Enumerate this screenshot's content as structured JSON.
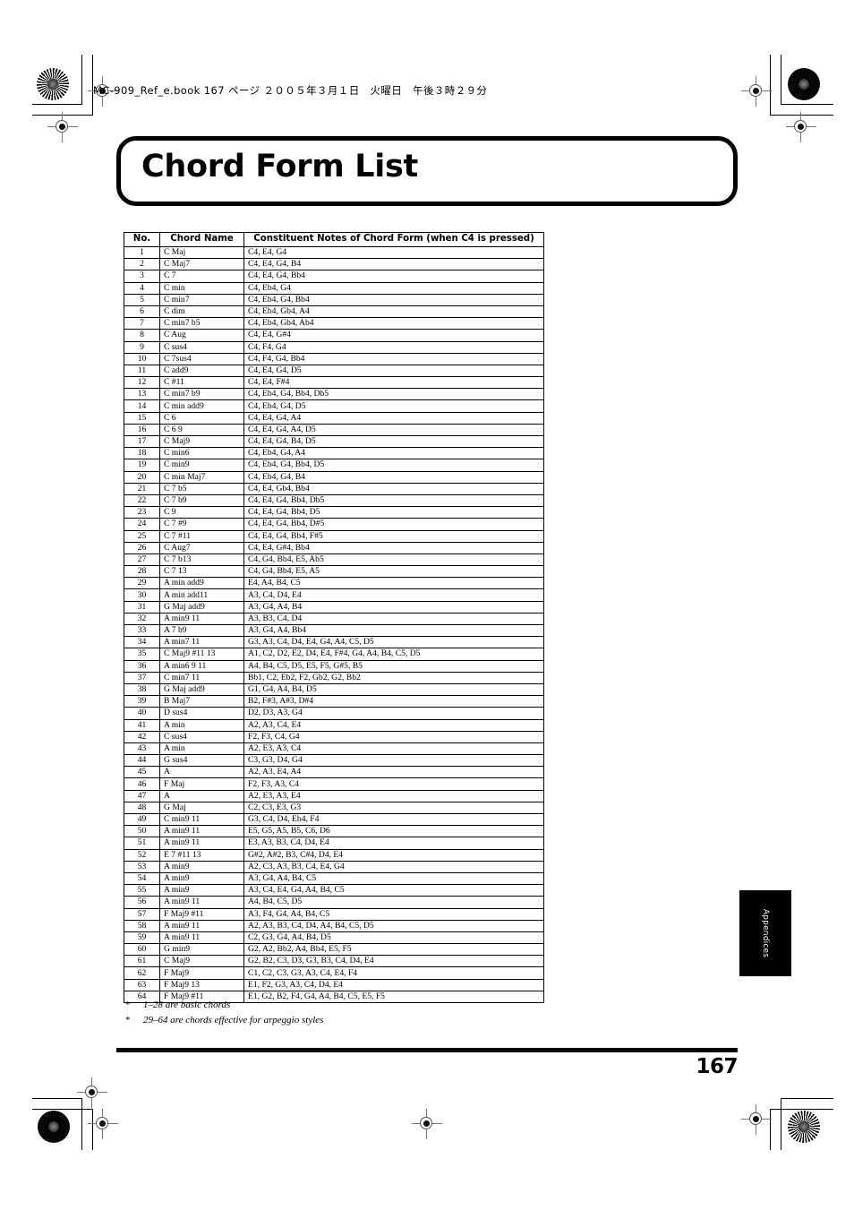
{
  "page": {
    "book_header": "MC-909_Ref_e.book  167 ページ  ２００５年３月１日　火曜日　午後３時２９分",
    "title": "Chord Form List",
    "folio": "167",
    "side_tab": "Appendices"
  },
  "table": {
    "headers": [
      "No.",
      "Chord Name",
      "Constituent Notes of Chord Form (when C4 is pressed)"
    ],
    "rows": [
      [
        "1",
        "C Maj",
        "C4, E4, G4"
      ],
      [
        "2",
        "C Maj7",
        "C4, E4, G4, B4"
      ],
      [
        "3",
        "C 7",
        "C4, E4, G4, Bb4"
      ],
      [
        "4",
        "C min",
        "C4, Eb4, G4"
      ],
      [
        "5",
        "C min7",
        "C4, Eb4, G4, Bb4"
      ],
      [
        "6",
        "C dim",
        "C4, Eb4, Gb4, A4"
      ],
      [
        "7",
        "C min7 b5",
        "C4, Eb4, Gb4, Ab4"
      ],
      [
        "8",
        "C Aug",
        "C4, E4, G#4"
      ],
      [
        "9",
        "C sus4",
        "C4, F4, G4"
      ],
      [
        "10",
        "C 7sus4",
        "C4, F4, G4, Bb4"
      ],
      [
        "11",
        "C add9",
        "C4, E4, G4, D5"
      ],
      [
        "12",
        "C #11",
        "C4, E4, F#4"
      ],
      [
        "13",
        "C min7 b9",
        "C4, Eb4, G4, Bb4, Db5"
      ],
      [
        "14",
        "C min add9",
        "C4, Eb4, G4, D5"
      ],
      [
        "15",
        "C 6",
        "C4, E4, G4, A4"
      ],
      [
        "16",
        "C 6 9",
        "C4, E4, G4, A4, D5"
      ],
      [
        "17",
        "C Maj9",
        "C4, E4, G4, B4, D5"
      ],
      [
        "18",
        "C min6",
        "C4, Eb4, G4, A4"
      ],
      [
        "19",
        "C min9",
        "C4, Eb4, G4, Bb4, D5"
      ],
      [
        "20",
        "C min Maj7",
        "C4, Eb4, G4, B4"
      ],
      [
        "21",
        "C 7 b5",
        "C4, E4, Gb4, Bb4"
      ],
      [
        "22",
        "C 7 b9",
        "C4, E4, G4, Bb4, Db5"
      ],
      [
        "23",
        "C 9",
        "C4, E4, G4, Bb4, D5"
      ],
      [
        "24",
        "C 7 #9",
        "C4, E4, G4, Bb4, D#5"
      ],
      [
        "25",
        "C 7 #11",
        "C4, E4, G4, Bb4, F#5"
      ],
      [
        "26",
        "C Aug7",
        "C4, E4, G#4, Bb4"
      ],
      [
        "27",
        "C 7 b13",
        "C4, G4, Bb4, E5, Ab5"
      ],
      [
        "28",
        "C 7 13",
        "C4, G4, Bb4, E5, A5"
      ],
      [
        "29",
        "A min add9",
        "E4, A4, B4, C5"
      ],
      [
        "30",
        "A min add11",
        "A3, C4, D4, E4"
      ],
      [
        "31",
        "G Maj add9",
        "A3, G4, A4, B4"
      ],
      [
        "32",
        "A min9 11",
        "A3, B3, C4, D4"
      ],
      [
        "33",
        "A 7 b9",
        "A3, G4, A4, Bb4"
      ],
      [
        "34",
        "A min7 11",
        "G3, A3, C4, D4, E4, G4, A4, C5, D5"
      ],
      [
        "35",
        "C Maj9 #11 13",
        "A1, C2, D2, E2, D4, E4, F#4, G4, A4, B4, C5, D5"
      ],
      [
        "36",
        "A min6 9 11",
        "A4, B4, C5, D5, E5, F5, G#5, B5"
      ],
      [
        "37",
        "C min7 11",
        "Bb1, C2, Eb2, F2, Gb2, G2, Bb2"
      ],
      [
        "38",
        "G Maj add9",
        "G1, G4, A4, B4, D5"
      ],
      [
        "39",
        "B Maj7",
        "B2, F#3, A#3, D#4"
      ],
      [
        "40",
        "D sus4",
        "D2, D3, A3, G4"
      ],
      [
        "41",
        "A min",
        "A2, A3, C4, E4"
      ],
      [
        "42",
        "C sus4",
        "F2, F3, C4, G4"
      ],
      [
        "43",
        "A min",
        "A2, E3, A3, C4"
      ],
      [
        "44",
        "G sus4",
        "C3, G3, D4, G4"
      ],
      [
        "45",
        "A",
        "A2, A3, E4, A4"
      ],
      [
        "46",
        "F Maj",
        "F2, F3, A3, C4"
      ],
      [
        "47",
        "A",
        "A2, E3, A3, E4"
      ],
      [
        "48",
        "G Maj",
        "C2, C3, E3, G3"
      ],
      [
        "49",
        "C min9 11",
        "G3, C4, D4, Eb4, F4"
      ],
      [
        "50",
        "A min9 11",
        "E5, G5, A5, B5, C6, D6"
      ],
      [
        "51",
        "A min9 11",
        "E3, A3, B3, C4, D4, E4"
      ],
      [
        "52",
        "E 7 #11 13",
        "G#2, A#2, B3, C#4, D4, E4"
      ],
      [
        "53",
        "A min9",
        "A2, C3, A3, B3, C4, E4, G4"
      ],
      [
        "54",
        "A min9",
        "A3, G4, A4, B4, C5"
      ],
      [
        "55",
        "A min9",
        "A3, C4, E4, G4, A4, B4, C5"
      ],
      [
        "56",
        "A min9 11",
        "A4, B4, C5, D5"
      ],
      [
        "57",
        "F Maj9 #11",
        "A3, F4, G4, A4, B4, C5"
      ],
      [
        "58",
        "A min9 11",
        "A2, A3, B3, C4, D4, A4, B4, C5, D5"
      ],
      [
        "59",
        "A min9 11",
        "C2, G3, G4, A4, B4, D5"
      ],
      [
        "60",
        "G min9",
        "G2, A2, Bb2, A4, Bb4, E5, F5"
      ],
      [
        "61",
        "C Maj9",
        "G2, B2, C3, D3, G3, B3, C4, D4, E4"
      ],
      [
        "62",
        "F Maj9",
        "C1, C2, C3, G3, A3, C4, E4, F4"
      ],
      [
        "63",
        "F Maj9 13",
        "E1, F2, G3, A3, C4, D4, E4"
      ],
      [
        "64",
        "F Maj9 #11",
        "E1, G2, B2, F4, G4, A4, B4, C5, E5, F5"
      ]
    ]
  },
  "footnotes": [
    {
      "marker": "*",
      "text": "1–28 are basic chords"
    },
    {
      "marker": "*",
      "text": "29–64 are chords effective for arpeggio styles"
    }
  ]
}
